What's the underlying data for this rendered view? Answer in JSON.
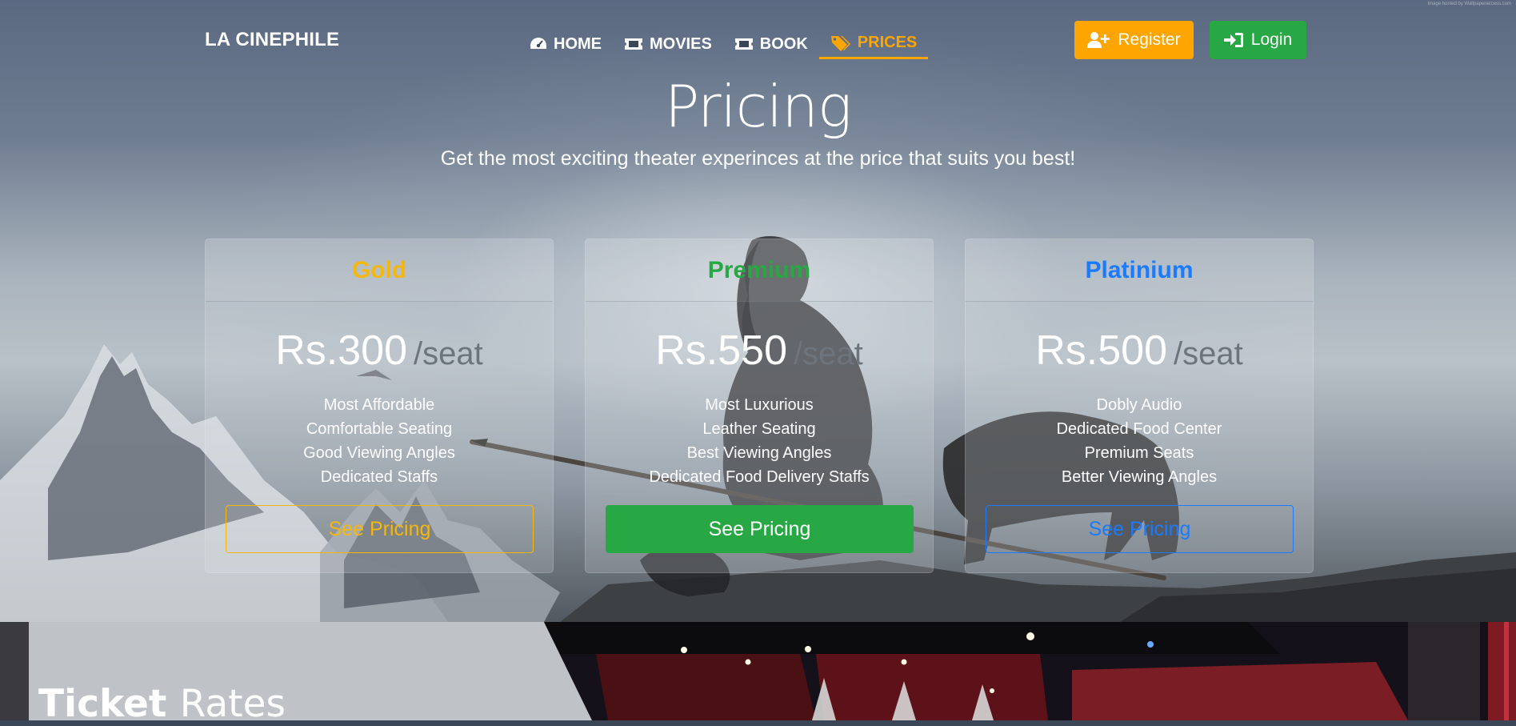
{
  "watermark": "Image hosted by Wallpaperaccess.com",
  "brand": "LA CINEPHILE",
  "nav": {
    "items": [
      {
        "label": "HOME",
        "icon": "speedometer-icon"
      },
      {
        "label": "MOVIES",
        "icon": "ticket-icon"
      },
      {
        "label": "BOOK",
        "icon": "ticket-icon"
      },
      {
        "label": "PRICES",
        "icon": "tags-icon",
        "active": true
      }
    ]
  },
  "auth": {
    "register_label": "Register",
    "login_label": "Login"
  },
  "hero": {
    "title": "Pricing",
    "subtitle": "Get the most exciting theater experinces at the price that suits you best!"
  },
  "plans": [
    {
      "name": "Gold",
      "price": "Rs.300",
      "unit": "/seat",
      "features": [
        "Most Affordable",
        "Comfortable Seating",
        "Good Viewing Angles",
        "Dedicated Staffs"
      ],
      "button": "See Pricing",
      "color": "#f3b70e"
    },
    {
      "name": "Premium",
      "price": "Rs.550",
      "unit": "/seat",
      "features": [
        "Most Luxurious",
        "Leather Seating",
        "Best Viewing Angles",
        "Dedicated Food Delivery Staffs"
      ],
      "button": "See Pricing",
      "color": "#28a745"
    },
    {
      "name": "Platinium",
      "price": "Rs.500",
      "unit": "/seat",
      "features": [
        "Dobly Audio",
        "Dedicated Food Center",
        "Premium Seats",
        "Better Viewing Angles"
      ],
      "button": "See Pricing",
      "color": "#1a7bff"
    }
  ],
  "section": {
    "title_bold": "Ticket",
    "title_rest": "Rates"
  },
  "colors": {
    "accent": "#ffa500",
    "success": "#28a745",
    "primary": "#1a7bff",
    "gold": "#f3b70e"
  }
}
